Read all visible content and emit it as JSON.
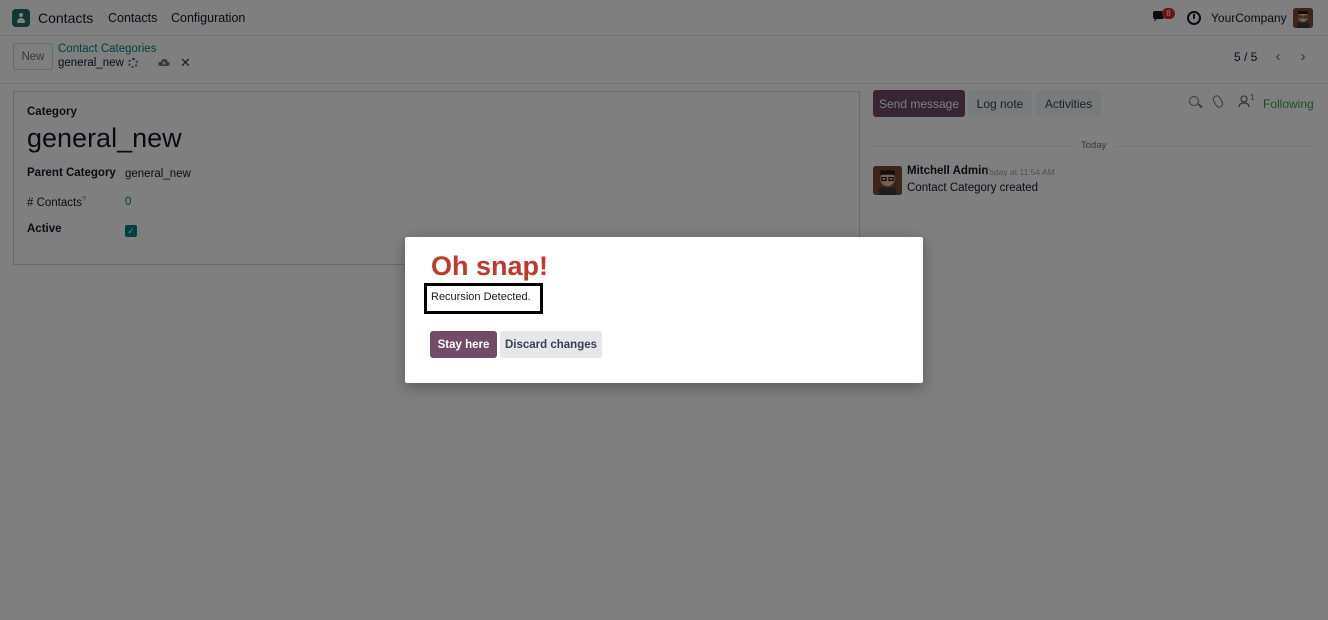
{
  "navbar": {
    "app_name": "Contacts",
    "menu": [
      "Contacts",
      "Configuration"
    ],
    "chat_badge": "8",
    "company": "YourCompany"
  },
  "control": {
    "new_label": "New",
    "breadcrumb_parent": "Contact Categories",
    "breadcrumb_current": "general_new",
    "pager": "5 / 5"
  },
  "form": {
    "category_label": "Category",
    "title": "general_new",
    "parent_label": "Parent Category",
    "parent_value": "general_new",
    "contacts_label": "# Contacts",
    "contacts_help": "?",
    "contacts_value": "0",
    "active_label": "Active",
    "active_checked": true
  },
  "chatter": {
    "send_message": "Send message",
    "log_note": "Log note",
    "activities": "Activities",
    "followers_count": "1",
    "following": "Following",
    "date_separator": "Today",
    "message": {
      "author": "Mitchell Admin",
      "time": "Today at 11:54 AM",
      "body": "Contact Category created"
    }
  },
  "dialog": {
    "title": "Oh snap!",
    "message": "Recursion Detected.",
    "stay_label": "Stay here",
    "discard_label": "Discard changes"
  },
  "colors": {
    "brand": "#714b67",
    "accent": "#017e84",
    "danger_title": "#c0392b",
    "following": "#28a745"
  }
}
